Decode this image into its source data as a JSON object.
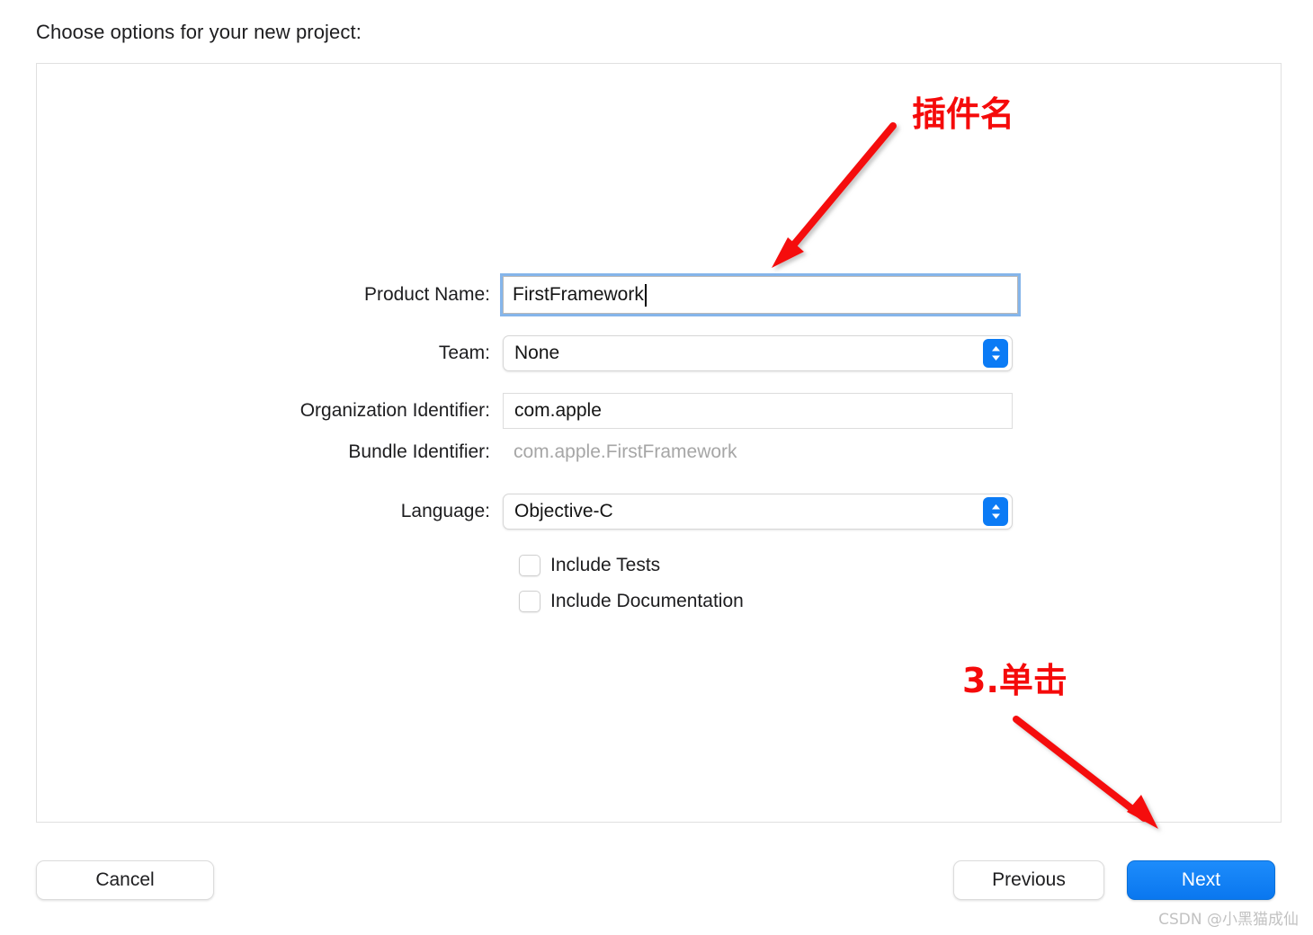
{
  "dialog": {
    "title": "Choose options for your new project:"
  },
  "form": {
    "product_name": {
      "label": "Product Name:",
      "value": "FirstFramework"
    },
    "team": {
      "label": "Team:",
      "value": "None",
      "options": [
        "None"
      ]
    },
    "organization_identifier": {
      "label": "Organization Identifier:",
      "value": "com.apple"
    },
    "bundle_identifier": {
      "label": "Bundle Identifier:",
      "value": "com.apple.FirstFramework"
    },
    "language": {
      "label": "Language:",
      "value": "Objective-C",
      "options": [
        "Objective-C"
      ]
    },
    "include_tests": {
      "label": "Include Tests",
      "checked": false
    },
    "include_documentation": {
      "label": "Include Documentation",
      "checked": false
    }
  },
  "footer": {
    "cancel_label": "Cancel",
    "previous_label": "Previous",
    "next_label": "Next"
  },
  "annotations": {
    "plugin_name": "插件名",
    "click_next": "3.单击",
    "color": "#f50a0a"
  },
  "watermark": {
    "text": "CSDN @小黑猫成仙"
  },
  "colors": {
    "accent_blue": "#0b7bf5",
    "focus_ring": "#85b5ea",
    "panel_border": "#e0e0e0",
    "readonly_text": "#a6a6a6"
  }
}
